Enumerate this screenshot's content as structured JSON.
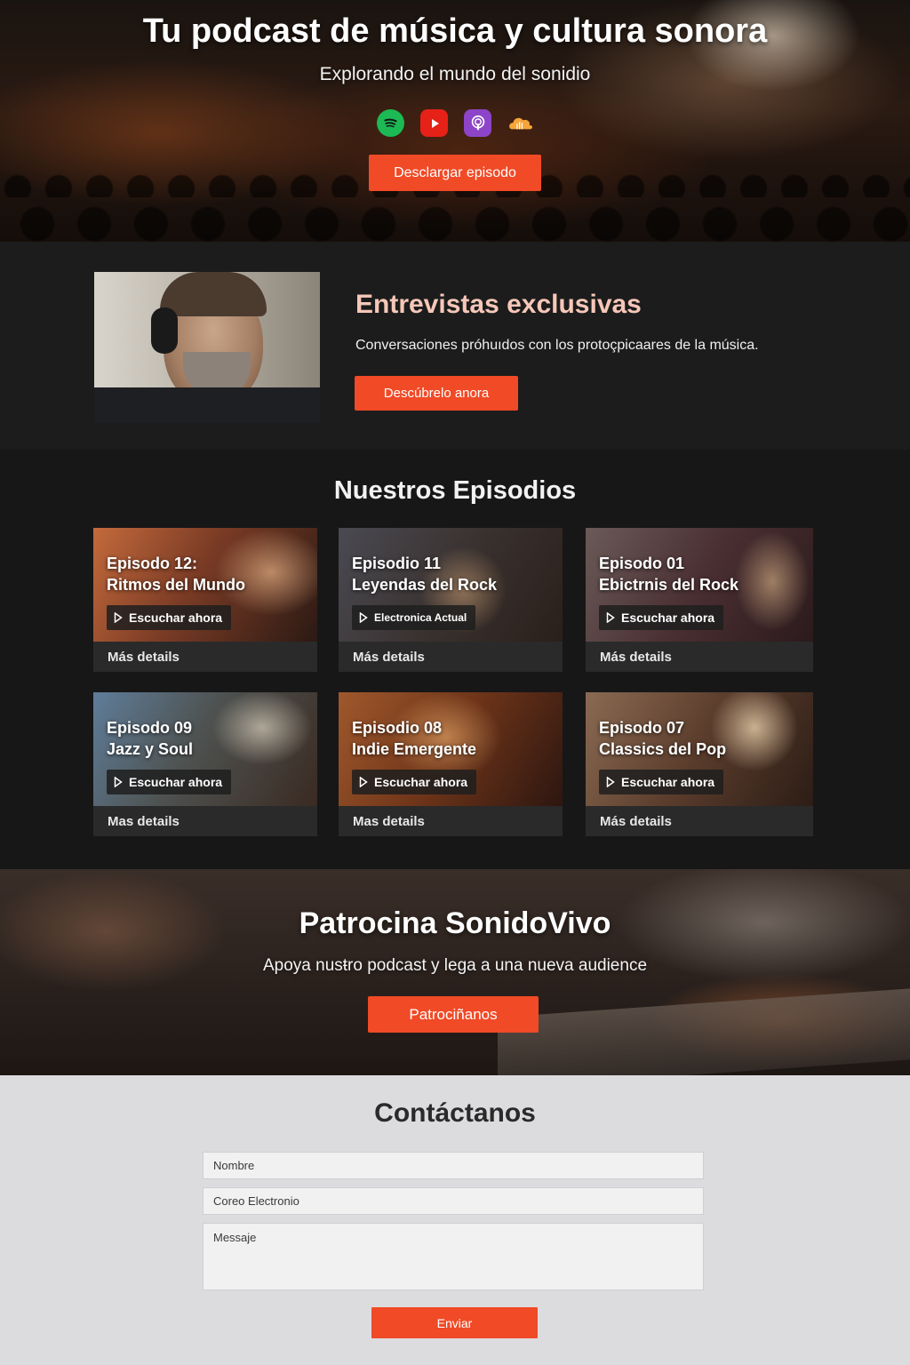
{
  "hero": {
    "title": "Tu podcast de música y cultura sonora",
    "subtitle": "Explorando el mundo del sonidio",
    "platforms": [
      "spotify-icon",
      "youtube-icon",
      "apple-podcasts-icon",
      "soundcloud-icon"
    ],
    "button_label": "Desclargar episodo"
  },
  "interviews": {
    "title": "Entrevistas exclusivas",
    "description": "Conversaciones próhuıdos con los protoçpicaares de la música.",
    "button_label": "Descúbrelo anora"
  },
  "episodes": {
    "title": "Nuestros Episodios",
    "items": [
      {
        "line1": "Episodo 12:",
        "line2": "Ritmos del Mundo",
        "play_label": "Escuchar ahora",
        "details_label": "Más details"
      },
      {
        "line1": "Episodio 11",
        "line2": "Leyendas del Rock",
        "play_label": "Electronica Actual",
        "details_label": "Más details"
      },
      {
        "line1": "Episodo 01",
        "line2": "Ebictrnis del Rock",
        "play_label": "Escuchar ahora",
        "details_label": "Más details"
      },
      {
        "line1": "Episodo 09",
        "line2": "Jazz y Soul",
        "play_label": "Escuchar ahora",
        "details_label": "Mas details"
      },
      {
        "line1": "Episodio 08",
        "line2": "Indie Emergente",
        "play_label": "Escuchar ahora",
        "details_label": "Mas details"
      },
      {
        "line1": "Episodo 07",
        "line2": "Classics del Pop",
        "play_label": "Escuchar ahora",
        "details_label": "Más details"
      }
    ]
  },
  "sponsor": {
    "title": "Patrocina SonidoVivo",
    "description": "Apoya nusŧro podcast y lega a una nueva audience",
    "button_label": "Patrociñanos"
  },
  "contact": {
    "title": "Contáctanos",
    "name_placeholder": "Nombre",
    "email_placeholder": "Coreo Electronio",
    "message_placeholder": "Messaje",
    "send_label": "Enviar"
  },
  "colors": {
    "accent": "#f04a26",
    "dark_bg": "#171717",
    "contact_bg": "#dcdcdf"
  }
}
